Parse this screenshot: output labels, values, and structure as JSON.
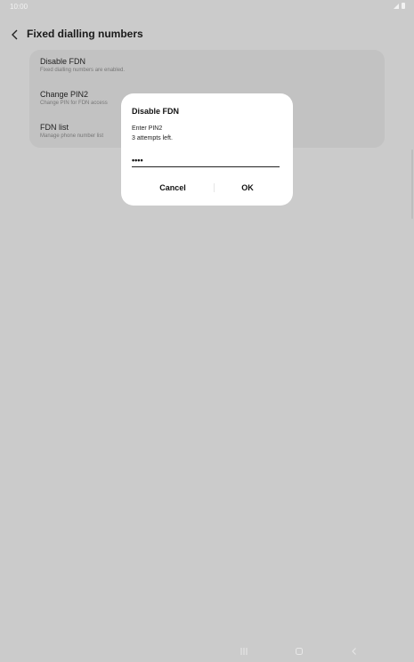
{
  "status_bar": {
    "time": "10:00"
  },
  "header": {
    "title": "Fixed dialling numbers"
  },
  "settings": {
    "items": [
      {
        "title": "Disable FDN",
        "subtitle": "Fixed dialling numbers are enabled."
      },
      {
        "title": "Change PIN2",
        "subtitle": "Change PIN for FDN access"
      },
      {
        "title": "FDN list",
        "subtitle": "Manage phone number list"
      }
    ]
  },
  "dialog": {
    "title": "Disable FDN",
    "message_line1": "Enter PIN2",
    "message_line2": "3 attempts left.",
    "pin_value": "••••",
    "cancel_label": "Cancel",
    "ok_label": "OK"
  },
  "navbar": {
    "icons": [
      "recents-icon",
      "home-icon",
      "back-icon"
    ]
  }
}
